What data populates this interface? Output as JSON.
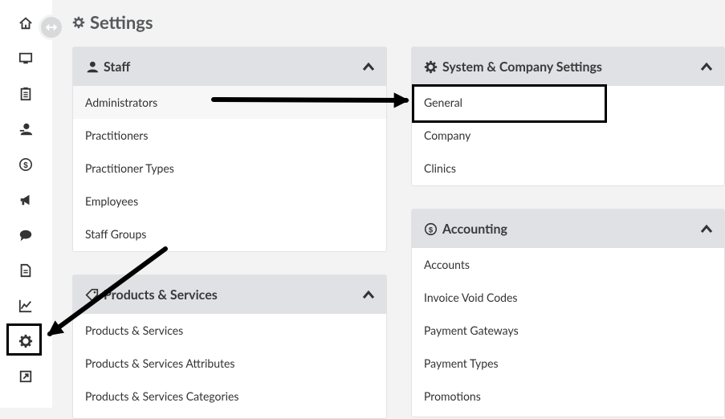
{
  "page": {
    "title": "Settings"
  },
  "sidebar": {
    "items": [
      {
        "name": "home-icon"
      },
      {
        "name": "monitor-icon"
      },
      {
        "name": "clipboard-icon"
      },
      {
        "name": "staff-icon"
      },
      {
        "name": "dollar-icon"
      },
      {
        "name": "megaphone-icon"
      },
      {
        "name": "chat-icon"
      },
      {
        "name": "document-icon"
      },
      {
        "name": "chart-icon"
      },
      {
        "name": "gear-icon"
      },
      {
        "name": "external-link-icon"
      }
    ]
  },
  "cards": {
    "staff": {
      "title": "Staff",
      "items": [
        "Administrators",
        "Practitioners",
        "Practitioner Types",
        "Employees",
        "Staff Groups"
      ]
    },
    "system": {
      "title": "System & Company Settings",
      "items": [
        "General",
        "Company",
        "Clinics"
      ]
    },
    "products": {
      "title": "Products & Services",
      "items": [
        "Products & Services",
        "Products & Services Attributes",
        "Products & Services Categories"
      ]
    },
    "accounting": {
      "title": "Accounting",
      "items": [
        "Accounts",
        "Invoice Void Codes",
        "Payment Gateways",
        "Payment Types",
        "Promotions"
      ]
    }
  },
  "colors": {
    "header_bg": "#dfe1e5",
    "page_bg": "#f3f3f3",
    "annotation": "#000000"
  }
}
